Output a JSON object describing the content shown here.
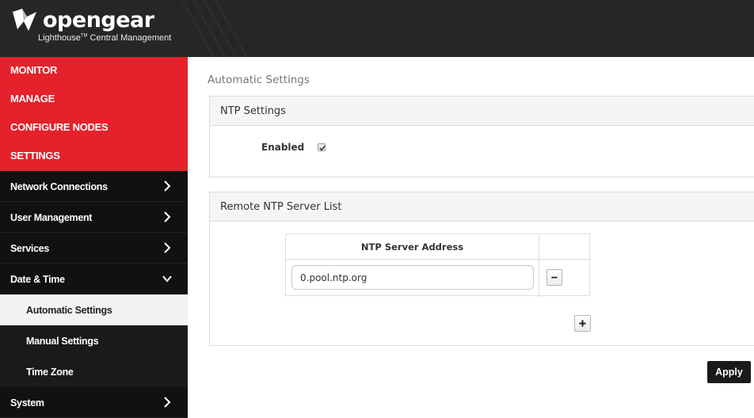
{
  "brand": {
    "name": "opengear",
    "tagline_main": "Lighthouse",
    "tagline_mark": "TM",
    "tagline_rest": " Central Management"
  },
  "sidebar": {
    "top_sections": [
      {
        "label": "MONITOR"
      },
      {
        "label": "MANAGE"
      },
      {
        "label": "CONFIGURE NODES"
      },
      {
        "label": "SETTINGS"
      }
    ],
    "items": [
      {
        "label": "Network Connections",
        "icon": "chevron-right-icon"
      },
      {
        "label": "User Management",
        "icon": "chevron-right-icon"
      },
      {
        "label": "Services",
        "icon": "chevron-right-icon"
      },
      {
        "label": "Date & Time",
        "icon": "chevron-down-icon",
        "expanded": true
      },
      {
        "label": "System",
        "icon": "chevron-right-icon"
      }
    ],
    "sub_items": [
      {
        "label": "Automatic Settings",
        "active": true
      },
      {
        "label": "Manual Settings",
        "active": false
      },
      {
        "label": "Time Zone",
        "active": false
      }
    ]
  },
  "main": {
    "title": "Automatic Settings",
    "ntp_settings": {
      "heading": "NTP Settings",
      "enabled_label": "Enabled",
      "enabled_checked": true
    },
    "server_list": {
      "heading": "Remote NTP Server List",
      "column_header": "NTP Server Address",
      "servers": [
        "0.pool.ntp.org"
      ]
    },
    "apply_label": "Apply"
  },
  "colors": {
    "accent_red": "#e5212b",
    "sidebar_bg": "#111111",
    "header_bg": "#262626"
  }
}
